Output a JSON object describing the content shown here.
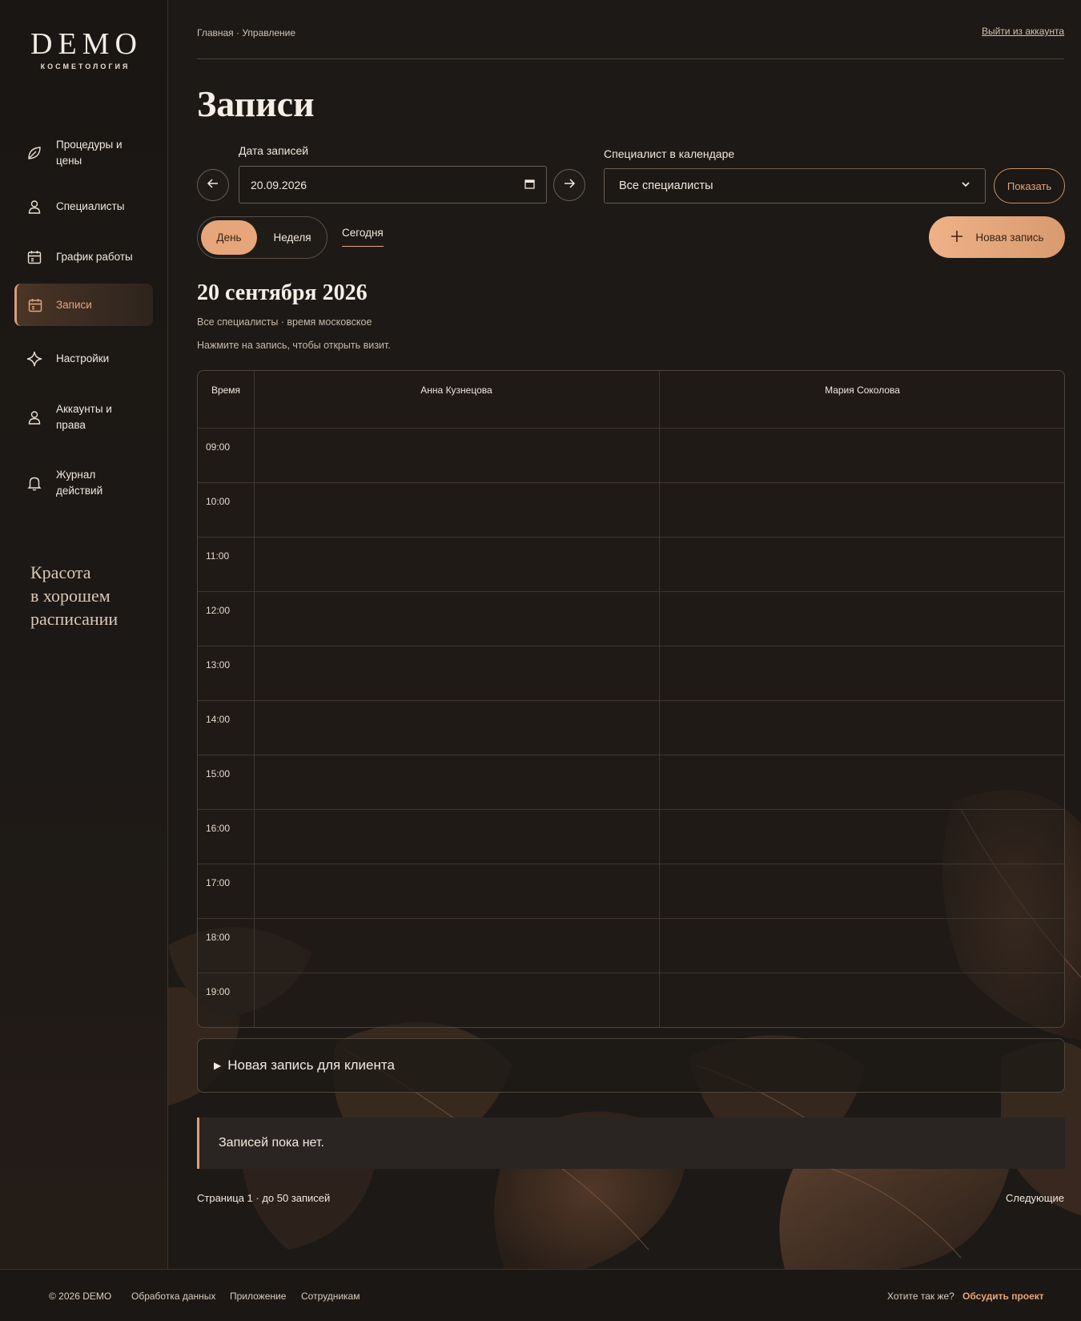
{
  "brand": {
    "title": "DEMO",
    "subtitle": "косметология"
  },
  "sidebar": {
    "items": [
      {
        "label": "Процедуры и цены",
        "icon": "leaf-icon"
      },
      {
        "label": "Специалисты",
        "icon": "user-icon"
      },
      {
        "label": "График работы",
        "icon": "calendar-icon"
      },
      {
        "label": "Записи",
        "icon": "calendar-icon",
        "active": true
      },
      {
        "label": "Настройки",
        "icon": "sparkle-icon"
      },
      {
        "label": "Аккаунты и права",
        "icon": "user-icon"
      },
      {
        "label": "Журнал действий",
        "icon": "bell-icon"
      }
    ],
    "tagline": [
      "Красота",
      "в хорошем",
      "расписании"
    ]
  },
  "header": {
    "breadcrumb": "Главная · Управление",
    "logout": "Выйти из аккаунта"
  },
  "page": {
    "title": "Записи"
  },
  "filters": {
    "date_label": "Дата записей",
    "date_value": "20.09.2026",
    "specialist_label": "Специалист в календаре",
    "specialist_value": "Все специалисты",
    "show_button": "Показать"
  },
  "view": {
    "day": "День",
    "week": "Неделя",
    "today": "Сегодня",
    "new_button": "Новая запись"
  },
  "schedule": {
    "date_heading": "20 сентября 2026",
    "meta": "Все специалисты · время московское",
    "hint": "Нажмите на запись, чтобы открыть визит.",
    "time_header": "Время",
    "specialists": [
      "Анна Кузнецова",
      "Мария Соколова"
    ],
    "times": [
      "09:00",
      "10:00",
      "11:00",
      "12:00",
      "13:00",
      "14:00",
      "15:00",
      "16:00",
      "17:00",
      "18:00",
      "19:00"
    ]
  },
  "new_for_client": "Новая запись для клиента",
  "empty_message": "Записей пока нет.",
  "pagination": {
    "info": "Страница 1 · до 50 записей",
    "next": "Следующие"
  },
  "footer": {
    "copyright": "© 2026 DEMO",
    "links": [
      "Обработка данных",
      "Приложение",
      "Сотрудникам"
    ],
    "question": "Хотите так же?",
    "cta": "Обсудить проект"
  },
  "colors": {
    "accent": "#e7a679",
    "background": "#1d1916"
  }
}
